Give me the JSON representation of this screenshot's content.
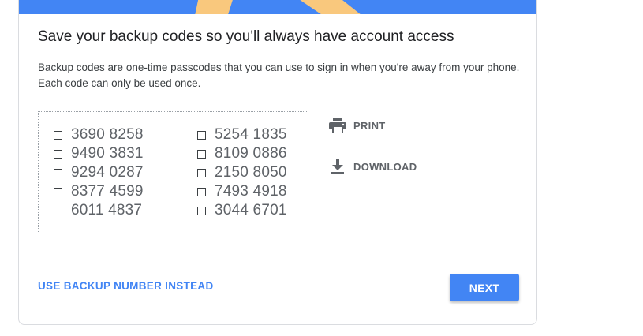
{
  "title": "Save your backup codes so you'll always have account access",
  "description": "Backup codes are one-time passcodes that you can use to sign in when you're away from your phone. Each code can only be used once.",
  "codes": {
    "left": [
      "3690 8258",
      "9490 3831",
      "9294 0287",
      "8377 4599",
      "6011 4837"
    ],
    "right": [
      "5254 1835",
      "8109 0886",
      "2150 8050",
      "7493 4918",
      "3044 6701"
    ]
  },
  "actions": {
    "print_label": "PRINT",
    "download_label": "DOWNLOAD"
  },
  "footer": {
    "alt_link_label": "USE BACKUP NUMBER INSTEAD",
    "next_label": "NEXT"
  },
  "colors": {
    "accent": "#4285f4",
    "illustration": "#f9c87d",
    "text_primary": "#202124",
    "text_secondary": "#5f6368"
  },
  "icons": {
    "print": "printer-icon",
    "download": "download-icon"
  }
}
